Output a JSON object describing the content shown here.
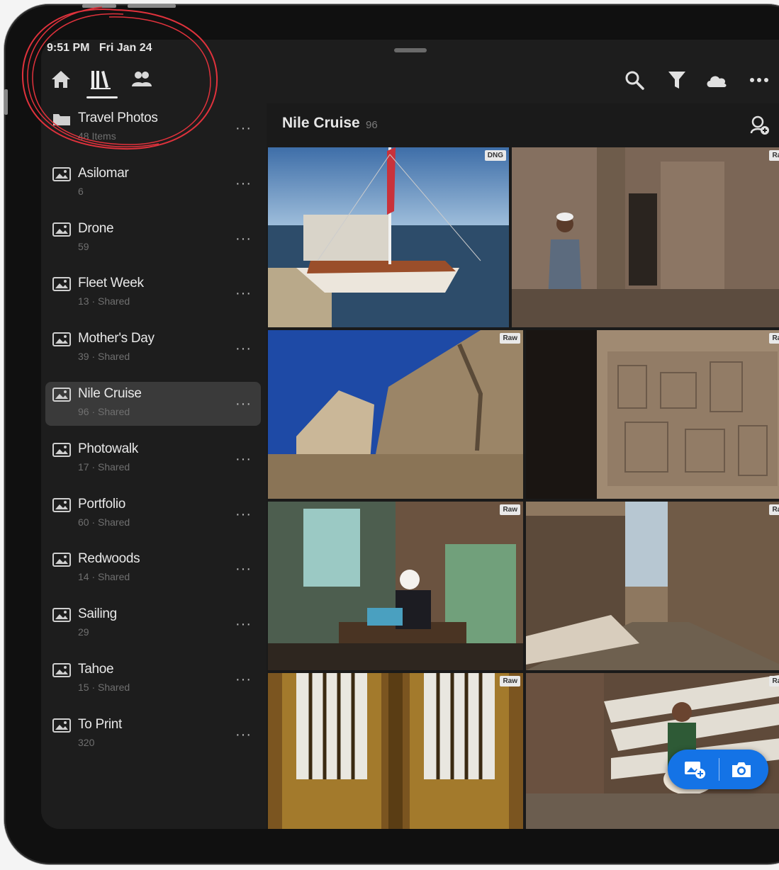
{
  "status_bar": {
    "time": "9:51 PM",
    "date": "Fri Jan 24"
  },
  "top_nav": {
    "tabs": [
      {
        "icon": "home-icon"
      },
      {
        "icon": "library-icon",
        "selected": true
      },
      {
        "icon": "people-icon"
      }
    ],
    "toolbar": [
      "search-icon",
      "filter-icon",
      "cloud-icon",
      "more-icon"
    ]
  },
  "sidebar": {
    "items": [
      {
        "name": "Travel Photos",
        "sub": "48 Items",
        "icon": "folder-icon"
      },
      {
        "name": "Asilomar",
        "sub": "6",
        "icon": "album-icon"
      },
      {
        "name": "Drone",
        "sub": "59",
        "icon": "album-icon"
      },
      {
        "name": "Fleet Week",
        "sub": "13 · Shared",
        "icon": "album-icon"
      },
      {
        "name": "Mother's Day",
        "sub": "39 · Shared",
        "icon": "album-icon"
      },
      {
        "name": "Nile Cruise",
        "sub": "96 · Shared",
        "icon": "album-icon",
        "selected": true
      },
      {
        "name": "Photowalk",
        "sub": "17 · Shared",
        "icon": "album-icon"
      },
      {
        "name": "Portfolio",
        "sub": "60 · Shared",
        "icon": "album-icon"
      },
      {
        "name": "Redwoods",
        "sub": "14 · Shared",
        "icon": "album-icon"
      },
      {
        "name": "Sailing",
        "sub": "29",
        "icon": "album-icon"
      },
      {
        "name": "Tahoe",
        "sub": "15 · Shared",
        "icon": "album-icon"
      },
      {
        "name": "To Print",
        "sub": "320",
        "icon": "album-icon"
      }
    ],
    "more_label": "···"
  },
  "album": {
    "title": "Nile Cruise",
    "count": "96"
  },
  "photos": [
    {
      "desc": "sailboat-on-nile",
      "badge": "DNG"
    },
    {
      "desc": "man-at-temple-doorway",
      "badge": "Raw"
    },
    {
      "desc": "temple-wall-and-building",
      "badge": "Raw"
    },
    {
      "desc": "hieroglyph-wall",
      "badge": "Raw"
    },
    {
      "desc": "tailor-workshop",
      "badge": "Raw"
    },
    {
      "desc": "village-alley",
      "badge": "Raw"
    },
    {
      "desc": "ornate-wooden-door",
      "badge": "Raw"
    },
    {
      "desc": "boy-with-lamb",
      "badge": "Raw"
    }
  ],
  "fab": {
    "left_icon": "add-photo-icon",
    "right_icon": "camera-icon"
  },
  "colors": {
    "accent": "#1473e6",
    "annotation": "#e0323c",
    "background": "#1d1d1d"
  }
}
